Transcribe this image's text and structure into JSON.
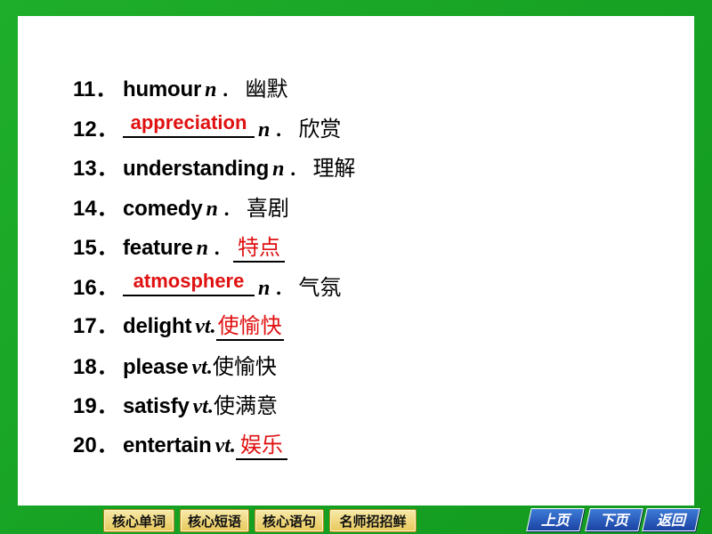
{
  "vocab": [
    {
      "num": "11．",
      "word": "humour",
      "pos": "n",
      "sep": "．",
      "meaning": "幽默",
      "answer": ""
    },
    {
      "num": "12．",
      "word": "",
      "pos": "n",
      "sep": "．",
      "meaning": "欣赏",
      "answer": "appreciation"
    },
    {
      "num": "13．",
      "word": "understanding",
      "pos": "n",
      "sep": "．",
      "meaning": "理解",
      "answer": ""
    },
    {
      "num": "14．",
      "word": "comedy",
      "pos": "n",
      "sep": "．",
      "meaning": "喜剧",
      "answer": ""
    },
    {
      "num": "15．",
      "word": "feature",
      "pos": "n",
      "sep": "．",
      "meaning": "",
      "answer": "特点"
    },
    {
      "num": "16．",
      "word": "",
      "pos": "n",
      "sep": "．",
      "meaning": "气氛",
      "answer": "atmosphere"
    },
    {
      "num": "17．",
      "word": "delight",
      "pos": "vt",
      "sep": ".",
      "meaning": "",
      "answer": "使愉快"
    },
    {
      "num": "18．",
      "word": "please",
      "pos": "vt",
      "sep": ".",
      "meaning": "使愉快",
      "answer": ""
    },
    {
      "num": "19．",
      "word": "satisfy",
      "pos": "vt",
      "sep": ".",
      "meaning": "使满意",
      "answer": ""
    },
    {
      "num": "20．",
      "word": "entertain",
      "pos": "vt",
      "sep": ".",
      "meaning": "",
      "answer": "娱乐"
    }
  ],
  "nav": {
    "core_words": "核心单词",
    "core_phrases": "核心短语",
    "core_sentences": "核心语句",
    "teacher_tips": "名师招招鲜",
    "prev": "上页",
    "next": "下页",
    "back": "返回"
  },
  "colors": {
    "answer": "#e01010",
    "background": "#18a325",
    "nav_button": "#e8c85a",
    "page_button": "#1b43a4"
  }
}
